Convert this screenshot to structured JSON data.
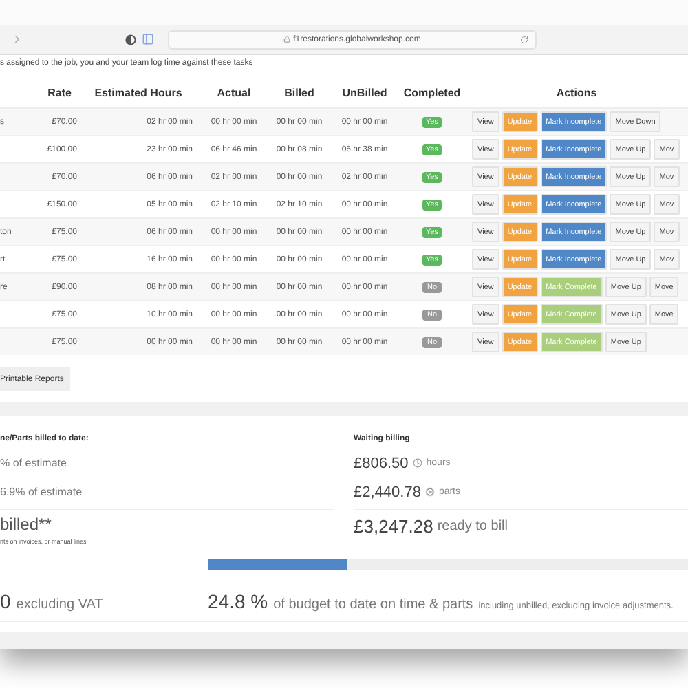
{
  "browser": {
    "url": "f1restorations.globalworkshop.com"
  },
  "intro": "s assigned to the job, you and your team log time against these tasks",
  "table": {
    "columns": [
      "Rate",
      "Estimated Hours",
      "Actual",
      "Billed",
      "UnBilled",
      "Completed",
      "Actions"
    ],
    "rows": [
      {
        "name": "s",
        "rate": "£70.00",
        "estimated": "02 hr 00 min",
        "actual": "00 hr 00 min",
        "billed": "00 hr 00 min",
        "unbilled": "00 hr 00 min",
        "completed": true,
        "completed_label": "Yes",
        "actions": [
          {
            "kind": "view",
            "label": "View"
          },
          {
            "kind": "update",
            "label": "Update"
          },
          {
            "kind": "mark_incomplete",
            "label": "Mark Incomplete"
          },
          {
            "kind": "move",
            "label": "Move Down"
          }
        ]
      },
      {
        "rate": "£100.00",
        "estimated": "23 hr 00 min",
        "actual": "06 hr 46 min",
        "billed": "00 hr 08 min",
        "unbilled": "06 hr 38 min",
        "completed": true,
        "completed_label": "Yes",
        "actions": [
          {
            "kind": "view",
            "label": "View"
          },
          {
            "kind": "update",
            "label": "Update"
          },
          {
            "kind": "mark_incomplete",
            "label": "Mark Incomplete"
          },
          {
            "kind": "move",
            "label": "Move Up"
          },
          {
            "kind": "move",
            "label": "Mov"
          }
        ]
      },
      {
        "rate": "£70.00",
        "estimated": "06 hr 00 min",
        "actual": "02 hr 00 min",
        "billed": "00 hr 00 min",
        "unbilled": "02 hr 00 min",
        "completed": true,
        "completed_label": "Yes",
        "actions": [
          {
            "kind": "view",
            "label": "View"
          },
          {
            "kind": "update",
            "label": "Update"
          },
          {
            "kind": "mark_incomplete",
            "label": "Mark Incomplete"
          },
          {
            "kind": "move",
            "label": "Move Up"
          },
          {
            "kind": "move",
            "label": "Mov"
          }
        ]
      },
      {
        "rate": "£150.00",
        "estimated": "05 hr 00 min",
        "actual": "02 hr 10 min",
        "billed": "02 hr 10 min",
        "unbilled": "00 hr 00 min",
        "completed": true,
        "completed_label": "Yes",
        "actions": [
          {
            "kind": "view",
            "label": "View"
          },
          {
            "kind": "update",
            "label": "Update"
          },
          {
            "kind": "mark_incomplete",
            "label": "Mark Incomplete"
          },
          {
            "kind": "move",
            "label": "Move Up"
          },
          {
            "kind": "move",
            "label": "Mov"
          }
        ]
      },
      {
        "name": "ton",
        "rate": "£75.00",
        "estimated": "06 hr 00 min",
        "actual": "00 hr 00 min",
        "billed": "00 hr 00 min",
        "unbilled": "00 hr 00 min",
        "completed": true,
        "completed_label": "Yes",
        "actions": [
          {
            "kind": "view",
            "label": "View"
          },
          {
            "kind": "update",
            "label": "Update"
          },
          {
            "kind": "mark_incomplete",
            "label": "Mark Incomplete"
          },
          {
            "kind": "move",
            "label": "Move Up"
          },
          {
            "kind": "move",
            "label": "Mov"
          }
        ]
      },
      {
        "name": "rt",
        "rate": "£75.00",
        "estimated": "16 hr 00 min",
        "actual": "00 hr 00 min",
        "billed": "00 hr 00 min",
        "unbilled": "00 hr 00 min",
        "completed": true,
        "completed_label": "Yes",
        "actions": [
          {
            "kind": "view",
            "label": "View"
          },
          {
            "kind": "update",
            "label": "Update"
          },
          {
            "kind": "mark_incomplete",
            "label": "Mark Incomplete"
          },
          {
            "kind": "move",
            "label": "Move Up"
          },
          {
            "kind": "move",
            "label": "Mov"
          }
        ]
      },
      {
        "name": "re",
        "rate": "£90.00",
        "estimated": "08 hr 00 min",
        "actual": "00 hr 00 min",
        "billed": "00 hr 00 min",
        "unbilled": "00 hr 00 min",
        "completed": false,
        "completed_label": "No",
        "actions": [
          {
            "kind": "view",
            "label": "View"
          },
          {
            "kind": "update",
            "label": "Update"
          },
          {
            "kind": "mark_complete",
            "label": "Mark Complete"
          },
          {
            "kind": "move",
            "label": "Move Up"
          },
          {
            "kind": "move",
            "label": "Move"
          }
        ]
      },
      {
        "rate": "£75.00",
        "estimated": "10 hr 00 min",
        "actual": "00 hr 00 min",
        "billed": "00 hr 00 min",
        "unbilled": "00 hr 00 min",
        "completed": false,
        "completed_label": "No",
        "actions": [
          {
            "kind": "view",
            "label": "View"
          },
          {
            "kind": "update",
            "label": "Update"
          },
          {
            "kind": "mark_complete",
            "label": "Mark Complete"
          },
          {
            "kind": "move",
            "label": "Move Up"
          },
          {
            "kind": "move",
            "label": "Move"
          }
        ]
      },
      {
        "rate": "£75.00",
        "estimated": "00 hr 00 min",
        "actual": "00 hr 00 min",
        "billed": "00 hr 00 min",
        "unbilled": "00 hr 00 min",
        "completed": false,
        "completed_label": "No",
        "actions": [
          {
            "kind": "view",
            "label": "View"
          },
          {
            "kind": "update",
            "label": "Update"
          },
          {
            "kind": "mark_complete",
            "label": "Mark Complete"
          },
          {
            "kind": "move",
            "label": "Move Up"
          }
        ]
      }
    ]
  },
  "reports_button": "Printable Reports",
  "billed_to_date": {
    "heading": "ne/Parts billed to date:",
    "lines": [
      "% of estimate",
      "6.9% of estimate"
    ],
    "total_label": "billed**",
    "note": "nts on invoices, or manual lines",
    "total": "0",
    "total_suffix": "excluding VAT"
  },
  "waiting_billing": {
    "heading": "Waiting billing",
    "items": [
      {
        "kind": "hours",
        "amount": "£806.50",
        "label": "hours"
      },
      {
        "kind": "parts",
        "amount": "£2,440.78",
        "label": "parts"
      }
    ],
    "total": "£3,247.28",
    "total_label": "ready to bill"
  },
  "budget": {
    "level": 0.29,
    "percent": "24.8 %",
    "label": "of budget to date on time & parts",
    "note": "including unbilled, excluding invoice adjustments."
  }
}
